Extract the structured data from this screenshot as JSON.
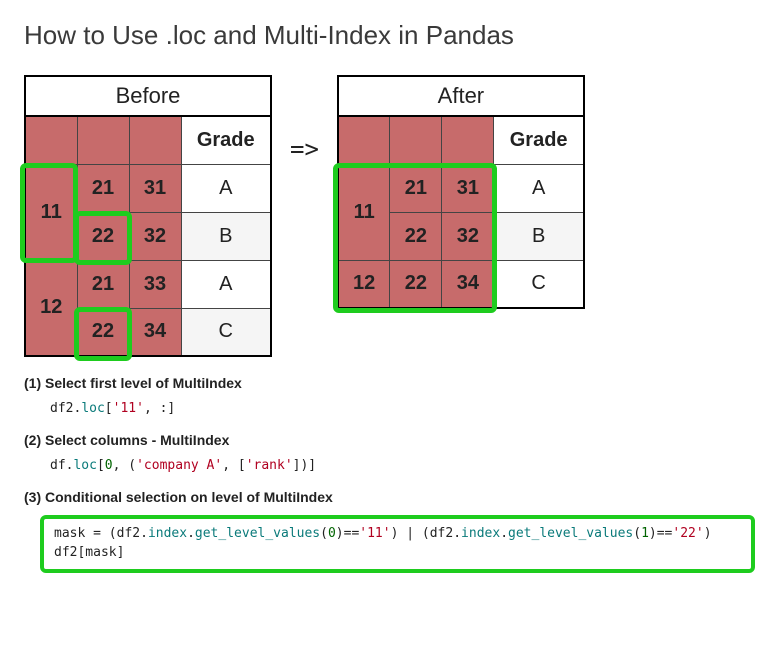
{
  "title": "How to Use .loc and Multi-Index in Pandas",
  "arrow": "=>",
  "before": {
    "caption": "Before",
    "col_header": "Grade",
    "rows": [
      {
        "l1": "11",
        "l2": "21",
        "l3": "31",
        "grade": "A"
      },
      {
        "l1": "",
        "l2": "22",
        "l3": "32",
        "grade": "B"
      },
      {
        "l1": "12",
        "l2": "21",
        "l3": "33",
        "grade": "A"
      },
      {
        "l1": "",
        "l2": "22",
        "l3": "34",
        "grade": "C"
      }
    ]
  },
  "after": {
    "caption": "After",
    "col_header": "Grade",
    "rows": [
      {
        "l1": "11",
        "l2": "21",
        "l3": "31",
        "grade": "A"
      },
      {
        "l1": "",
        "l2": "22",
        "l3": "32",
        "grade": "B"
      },
      {
        "l1": "12",
        "l2": "22",
        "l3": "34",
        "grade": "C"
      }
    ]
  },
  "steps": {
    "s1_label": "(1) Select first level of MultiIndex",
    "s1_code": {
      "p1": "df2.",
      "attr": "loc",
      "p2": "[",
      "str": "'11'",
      "p3": ", :]"
    },
    "s2_label": "(2) Select columns - MultiIndex",
    "s2_code": {
      "p1": "df.",
      "attr": "loc",
      "p2": "[",
      "num": "0",
      "p3": ", (",
      "str1": "'company A'",
      "p4": ", [",
      "str2": "'rank'",
      "p5": "])]"
    },
    "s3_label": "(3) Conditional selection on level of MultiIndex",
    "s3_code": {
      "l1a": "mask ",
      "l1b": "=",
      "l1c": " (df2.",
      "attr1": "index",
      "l1d": ".",
      "attr2": "get_level_values",
      "l1e": "(",
      "num1": "0",
      "l1f": ")",
      "l1g": "==",
      "str1": "'11'",
      "l1h": ") ",
      "l1i": "|",
      "l1j": " (df2.",
      "attr3": "index",
      "l1k": ".",
      "attr4": "get_level_values",
      "l1l": "(",
      "num2": "1",
      "l1m": ")",
      "l1n": "==",
      "str2": "'22'",
      "l1o": ")",
      "l2": "df2[mask]"
    }
  }
}
